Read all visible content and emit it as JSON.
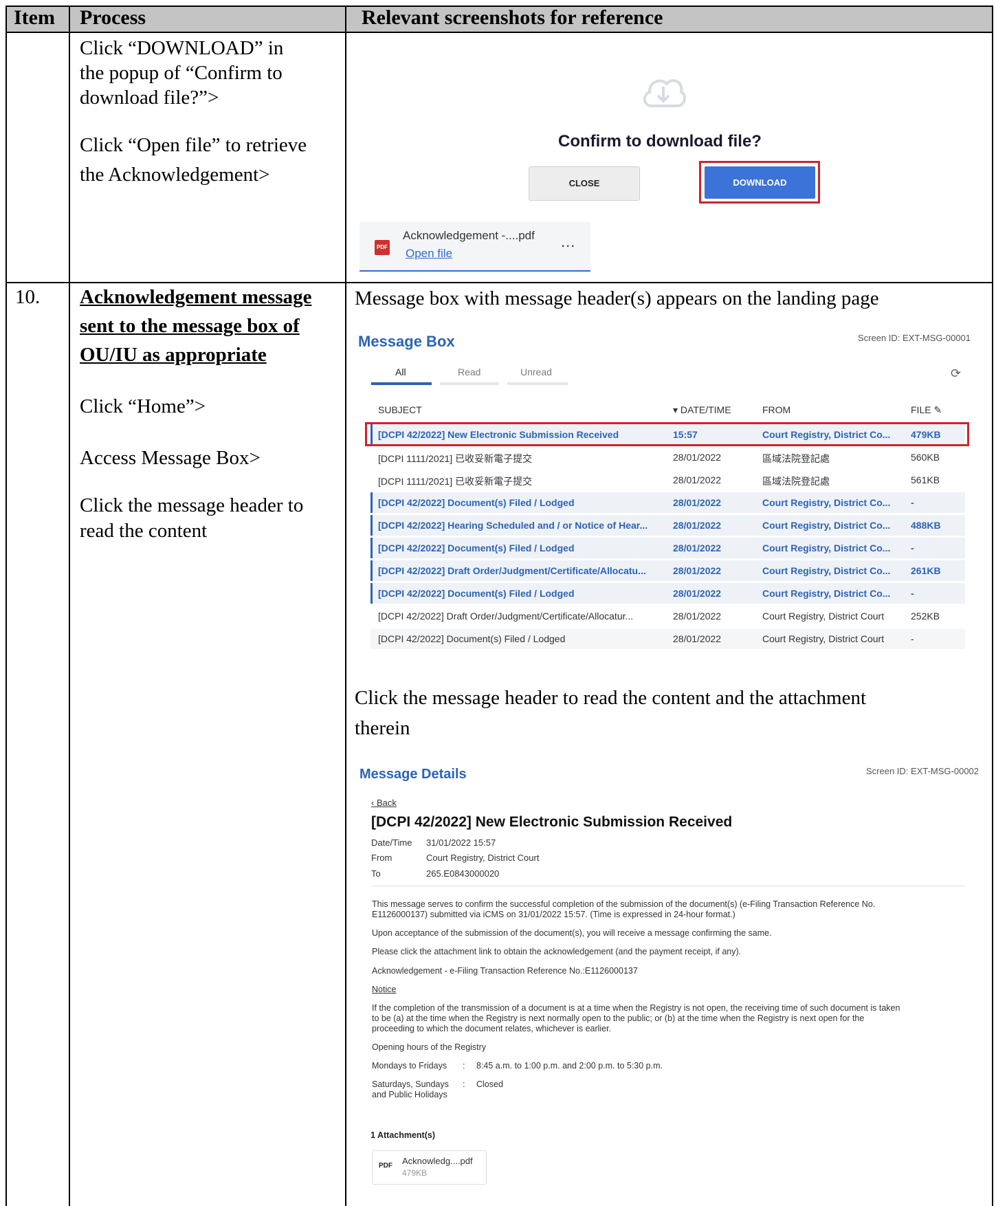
{
  "table": {
    "headers": {
      "item": "Item",
      "process": "Process",
      "screenshots": "Relevant screenshots for reference"
    }
  },
  "row1": {
    "process_lines": [
      "Click “DOWNLOAD” in",
      "the popup of “Confirm to",
      "download file?”>",
      "Click “Open file” to retrieve",
      "the Acknowledgement>"
    ],
    "popup": {
      "title": "Confirm to download file?",
      "close_label": "CLOSE",
      "download_label": "DOWNLOAD"
    },
    "download_bar": {
      "badge": "PDF",
      "file_name": "Acknowledgement -....pdf",
      "open_link": "Open file",
      "more": "..."
    }
  },
  "row2": {
    "item": "10.",
    "heading_lines": [
      "Acknowledgement message",
      "sent to the message box of",
      "OU/IU as appropriate"
    ],
    "steps": [
      "Click “Home”>",
      "Access Message Box>",
      "Click the message header to",
      "read the content"
    ],
    "caption1": "Message box with message header(s) appears on the landing page",
    "caption2_lines": [
      "Click the message header to read the content and the attachment",
      "therein"
    ]
  },
  "message_box": {
    "title": "Message Box",
    "screen_id": "Screen ID: EXT-MSG-00001",
    "tabs": [
      "All",
      "Read",
      "Unread"
    ],
    "refresh": "⟳",
    "columns": {
      "subject": "SUBJECT",
      "datetime": "▾ DATE/TIME",
      "from": "FROM",
      "file": "FILE ✎"
    },
    "rows": [
      {
        "subject": "[DCPI 42/2022] New Electronic Submission Received",
        "datetime": "15:57",
        "from": "Court Registry, District Co...",
        "file": "479KB",
        "unread": true
      },
      {
        "subject": "[DCPI 1111/2021] 已收妥新電子提交",
        "datetime": "28/01/2022",
        "from": "區域法院登記處",
        "file": "560KB",
        "unread": false
      },
      {
        "subject": "[DCPI 1111/2021] 已收妥新電子提交",
        "datetime": "28/01/2022",
        "from": "區域法院登記處",
        "file": "561KB",
        "unread": false
      },
      {
        "subject": "[DCPI 42/2022] Document(s) Filed / Lodged",
        "datetime": "28/01/2022",
        "from": "Court Registry, District Co...",
        "file": "-",
        "unread": true
      },
      {
        "subject": "[DCPI 42/2022] Hearing Scheduled and / or Notice of Hear...",
        "datetime": "28/01/2022",
        "from": "Court Registry, District Co...",
        "file": "488KB",
        "unread": true
      },
      {
        "subject": "[DCPI 42/2022] Document(s) Filed / Lodged",
        "datetime": "28/01/2022",
        "from": "Court Registry, District Co...",
        "file": "-",
        "unread": true
      },
      {
        "subject": "[DCPI 42/2022] Draft Order/Judgment/Certificate/Allocatu...",
        "datetime": "28/01/2022",
        "from": "Court Registry, District Co...",
        "file": "261KB",
        "unread": true
      },
      {
        "subject": "[DCPI 42/2022] Document(s) Filed / Lodged",
        "datetime": "28/01/2022",
        "from": "Court Registry, District Co...",
        "file": "-",
        "unread": true
      },
      {
        "subject": "[DCPI 42/2022] Draft Order/Judgment/Certificate/Allocatur...",
        "datetime": "28/01/2022",
        "from": "Court Registry, District Court",
        "file": "252KB",
        "unread": false
      },
      {
        "subject": "[DCPI 42/2022] Document(s) Filed / Lodged",
        "datetime": "28/01/2022",
        "from": "Court Registry, District Court",
        "file": "-",
        "unread": false
      }
    ]
  },
  "message_details": {
    "title": "Message Details",
    "screen_id": "Screen ID: EXT-MSG-00002",
    "back": "‹ Back",
    "subject": "[DCPI 42/2022]  New Electronic Submission Received",
    "meta": {
      "date_label": "Date/Time",
      "date_value": "31/01/2022 15:57",
      "from_label": "From",
      "from_value": "Court Registry, District Court",
      "to_label": "To",
      "to_value": "265.E0843000020"
    },
    "body": {
      "p1_lines": [
        "This message serves to confirm the successful completion of the submission of the document(s) (e-Filing Transaction Reference No.",
        "E1126000137) submitted via iCMS on 31/01/2022 15:57. (Time is expressed in 24-hour format.)"
      ],
      "p2": "Upon acceptance of the submission of the document(s), you will receive a message confirming the same.",
      "p3": "Please click the attachment link to obtain the acknowledgement (and the payment receipt, if any).",
      "p4": "Acknowledgement - e-Filing Transaction Reference No.:E1126000137",
      "notice": "Notice",
      "p5_lines": [
        "If the completion of the transmission of a document is at a time when the Registry is not open, the receiving time of such document is taken",
        "to be (a) at the time when the Registry is next normally open to the public; or (b) at the time when the Registry is next open for the",
        "proceeding to which the document relates, whichever is earlier."
      ],
      "hours_title": "Opening hours of the Registry",
      "weekdays_label": "Mondays to Fridays",
      "weekdays_sep": ":",
      "weekdays_value": "8:45 a.m. to 1:00 p.m. and 2:00 p.m. to 5:30 p.m.",
      "weekend_label_lines": [
        "Saturdays, Sundays",
        "and Public Holidays"
      ],
      "weekend_sep": ":",
      "weekend_value": "Closed"
    },
    "attachments": {
      "title": "1 Attachment(s)",
      "badge": "PDF",
      "name": "Acknowledg....pdf",
      "size": "479KB"
    }
  },
  "colors": {
    "accent": "#2d63b4",
    "highlight": "#d1222b",
    "download_button": "#3b73d8",
    "header_gray": "#c4c4c4"
  }
}
